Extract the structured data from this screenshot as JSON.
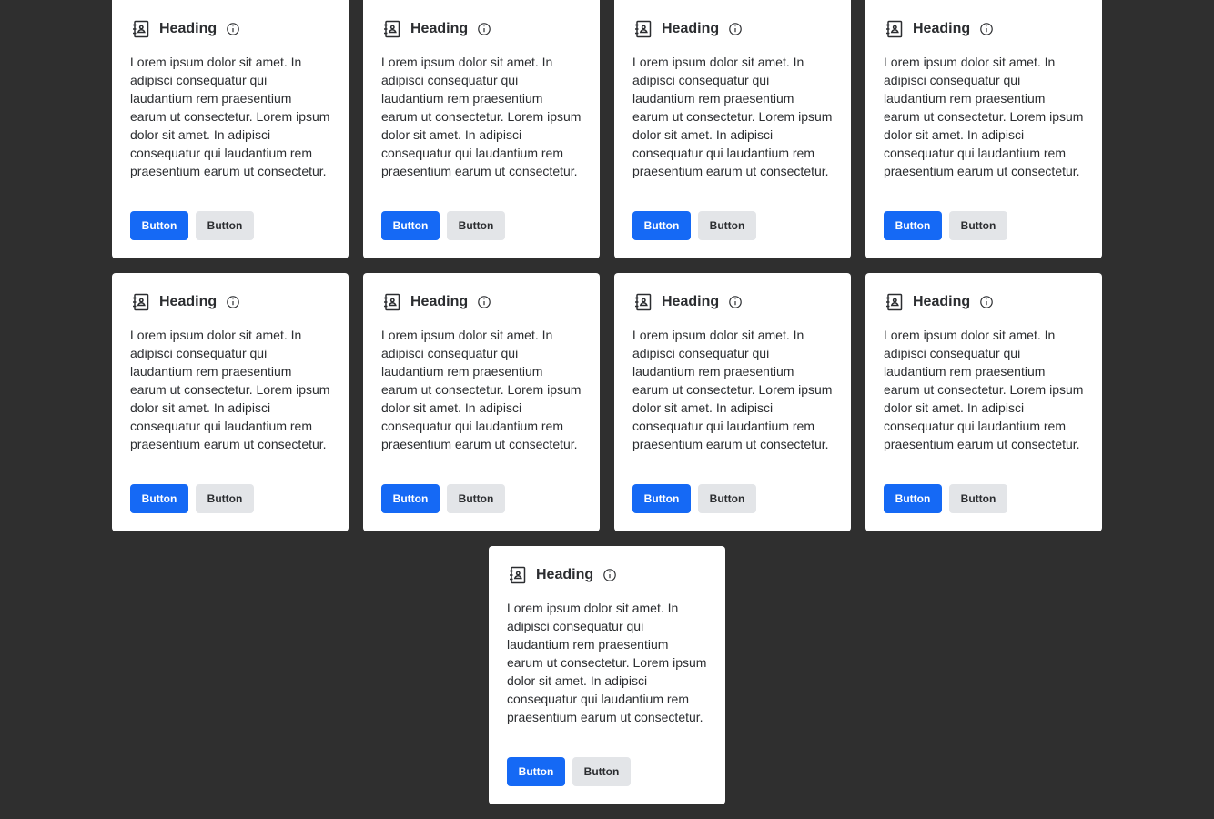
{
  "cards": [
    {
      "heading": "Heading",
      "body": "Lorem ipsum dolor sit amet. In adipisci consequatur qui laudantium rem praesentium earum ut consectetur. Lorem ipsum dolor sit amet. In adipisci consequatur qui laudantium rem praesentium earum ut consectetur.",
      "primary_label": "Button",
      "secondary_label": "Button",
      "icon": "contact-book-icon",
      "info_icon": "info-icon"
    },
    {
      "heading": "Heading",
      "body": "Lorem ipsum dolor sit amet. In adipisci consequatur qui laudantium rem praesentium earum ut consectetur. Lorem ipsum dolor sit amet. In adipisci consequatur qui laudantium rem praesentium earum ut consectetur.",
      "primary_label": "Button",
      "secondary_label": "Button",
      "icon": "contact-book-icon",
      "info_icon": "info-icon"
    },
    {
      "heading": "Heading",
      "body": "Lorem ipsum dolor sit amet. In adipisci consequatur qui laudantium rem praesentium earum ut consectetur. Lorem ipsum dolor sit amet. In adipisci consequatur qui laudantium rem praesentium earum ut consectetur.",
      "primary_label": "Button",
      "secondary_label": "Button",
      "icon": "contact-book-icon",
      "info_icon": "info-icon"
    },
    {
      "heading": "Heading",
      "body": "Lorem ipsum dolor sit amet. In adipisci consequatur qui laudantium rem praesentium earum ut consectetur. Lorem ipsum dolor sit amet. In adipisci consequatur qui laudantium rem praesentium earum ut consectetur.",
      "primary_label": "Button",
      "secondary_label": "Button",
      "icon": "contact-book-icon",
      "info_icon": "info-icon"
    },
    {
      "heading": "Heading",
      "body": "Lorem ipsum dolor sit amet. In adipisci consequatur qui laudantium rem praesentium earum ut consectetur. Lorem ipsum dolor sit amet. In adipisci consequatur qui laudantium rem praesentium earum ut consectetur.",
      "primary_label": "Button",
      "secondary_label": "Button",
      "icon": "contact-book-icon",
      "info_icon": "info-icon"
    },
    {
      "heading": "Heading",
      "body": "Lorem ipsum dolor sit amet. In adipisci consequatur qui laudantium rem praesentium earum ut consectetur. Lorem ipsum dolor sit amet. In adipisci consequatur qui laudantium rem praesentium earum ut consectetur.",
      "primary_label": "Button",
      "secondary_label": "Button",
      "icon": "contact-book-icon",
      "info_icon": "info-icon"
    },
    {
      "heading": "Heading",
      "body": "Lorem ipsum dolor sit amet. In adipisci consequatur qui laudantium rem praesentium earum ut consectetur. Lorem ipsum dolor sit amet. In adipisci consequatur qui laudantium rem praesentium earum ut consectetur.",
      "primary_label": "Button",
      "secondary_label": "Button",
      "icon": "contact-book-icon",
      "info_icon": "info-icon"
    },
    {
      "heading": "Heading",
      "body": "Lorem ipsum dolor sit amet. In adipisci consequatur qui laudantium rem praesentium earum ut consectetur. Lorem ipsum dolor sit amet. In adipisci consequatur qui laudantium rem praesentium earum ut consectetur.",
      "primary_label": "Button",
      "secondary_label": "Button",
      "icon": "contact-book-icon",
      "info_icon": "info-icon"
    },
    {
      "heading": "Heading",
      "body": "Lorem ipsum dolor sit amet. In adipisci consequatur qui laudantium rem praesentium earum ut consectetur. Lorem ipsum dolor sit amet. In adipisci consequatur qui laudantium rem praesentium earum ut consectetur.",
      "primary_label": "Button",
      "secondary_label": "Button",
      "icon": "contact-book-icon",
      "info_icon": "info-icon"
    }
  ],
  "colors": {
    "background": "#2f2f2f",
    "card": "#ffffff",
    "primary": "#1569f5",
    "secondary": "#e3e5e8",
    "text": "#2b2d30"
  }
}
